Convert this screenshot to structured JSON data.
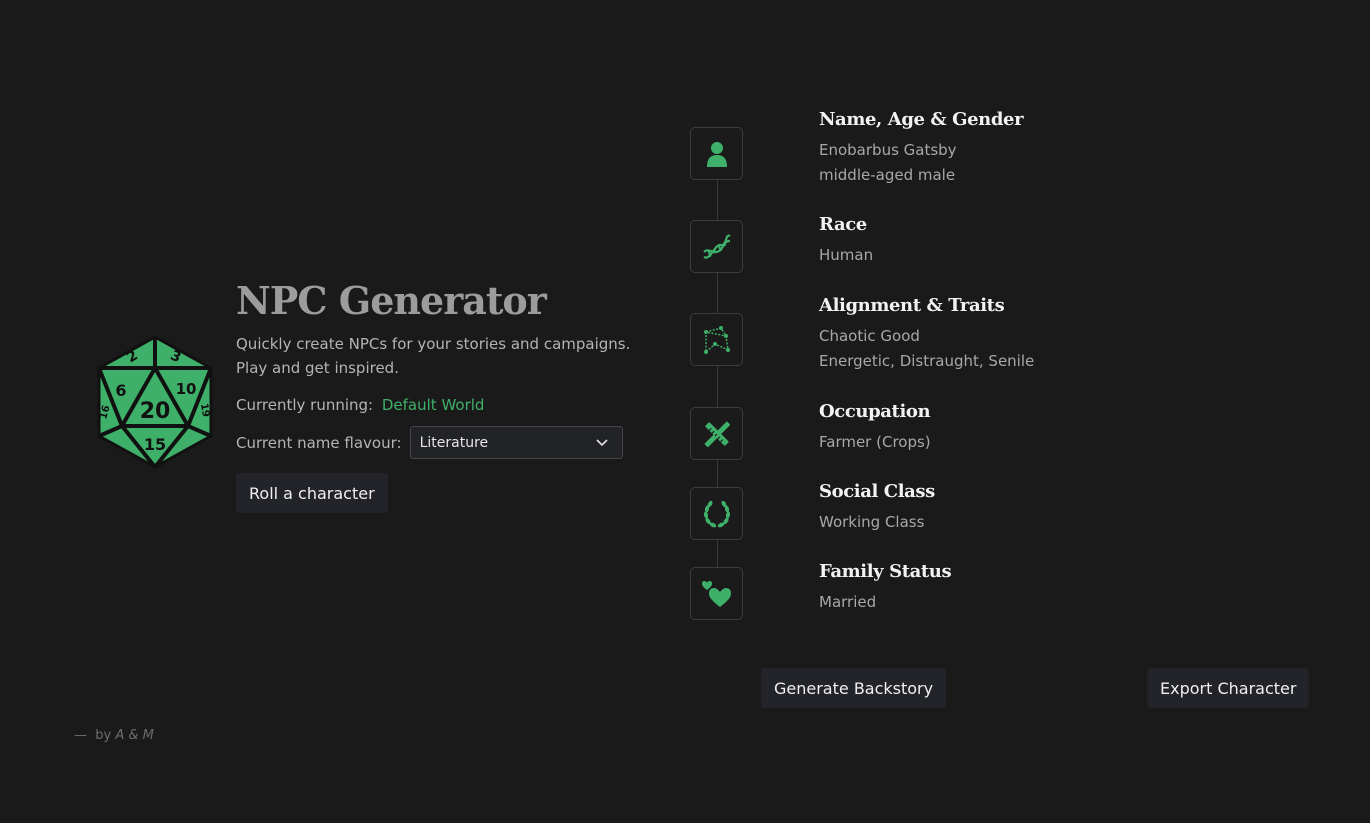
{
  "app": {
    "title": "NPC Generator",
    "tagline": "Quickly create NPCs for your stories and campaigns. Play and get inspired.",
    "running_label": "Currently running:",
    "running_world": "Default World",
    "flavour_label": "Current name flavour:",
    "flavour_value": "Literature",
    "roll_button": "Roll a character",
    "logo_icon": "d20-dice-icon",
    "dice_numbers": [
      "2",
      "3",
      "6",
      "20",
      "10",
      "16",
      "19",
      "15"
    ]
  },
  "character": {
    "name_section": {
      "title": "Name, Age & Gender",
      "values": [
        "Enobarbus Gatsby",
        "middle-aged male"
      ],
      "icon": "person-icon"
    },
    "race_section": {
      "title": "Race",
      "values": [
        "Human"
      ],
      "icon": "dna-icon"
    },
    "alignment_section": {
      "title": "Alignment & Traits",
      "values": [
        "Chaotic Good",
        "Energetic, Distraught, Senile"
      ],
      "icon": "constellation-icon"
    },
    "occupation_section": {
      "title": "Occupation",
      "values": [
        "Farmer (Crops)"
      ],
      "icon": "crossed-tools-icon"
    },
    "social_section": {
      "title": "Social Class",
      "values": [
        "Working Class"
      ],
      "icon": "laurel-wreath-icon"
    },
    "family_section": {
      "title": "Family Status",
      "values": [
        "Married"
      ],
      "icon": "hearts-icon"
    }
  },
  "actions": {
    "backstory_button": "Generate Backstory",
    "export_button": "Export Character"
  },
  "footer": {
    "dash": "—",
    "by": "by",
    "authors": "A & M"
  },
  "colors": {
    "background": "#1a1a1b",
    "accent": "#3fb06a",
    "button_bg": "#222429"
  }
}
